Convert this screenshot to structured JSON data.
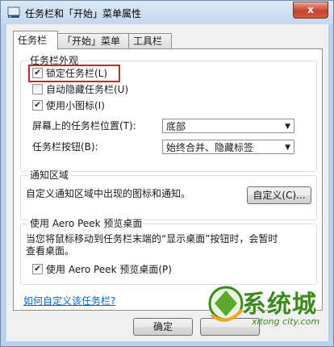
{
  "window": {
    "title": "任务栏和「开始」菜单属性",
    "close_label": "x"
  },
  "tabs": [
    {
      "label": "任务栏",
      "active": true
    },
    {
      "label": "「开始」菜单",
      "active": false
    },
    {
      "label": "工具栏",
      "active": false
    }
  ],
  "appearance": {
    "group_label": "任务栏外观",
    "lock_taskbar": {
      "label": "锁定任务栏(L)",
      "checked": true
    },
    "auto_hide": {
      "label": "自动隐藏任务栏(U)",
      "checked": false
    },
    "small_icons": {
      "label": "使用小图标(I)",
      "checked": true
    },
    "location": {
      "label": "屏幕上的任务栏位置(T):",
      "value": "底部"
    },
    "buttons": {
      "label": "任务栏按钮(B):",
      "value": "始终合并、隐藏标签"
    }
  },
  "notification": {
    "group_label": "通知区域",
    "description": "自定义通知区域中出现的图标和通知。",
    "customize_button": "自定义(C)..."
  },
  "aero_peek": {
    "group_label": "使用 Aero Peek 预览桌面",
    "description_line1": "当您将鼠标移动到任务栏末端的“显示桌面”按钮时，会暂时",
    "description_line2": "查看桌面。",
    "checkbox": {
      "label": "使用 Aero Peek 预览桌面(P)",
      "checked": true
    }
  },
  "help_link": "如何自定义该任务栏?",
  "footer": {
    "ok_button": "确定"
  },
  "watermark": {
    "text": "系统城",
    "domain": "xitong city.com"
  },
  "colors": {
    "highlight": "#c0282d",
    "link": "#0066cc",
    "watermark": "#3a8a1c"
  }
}
